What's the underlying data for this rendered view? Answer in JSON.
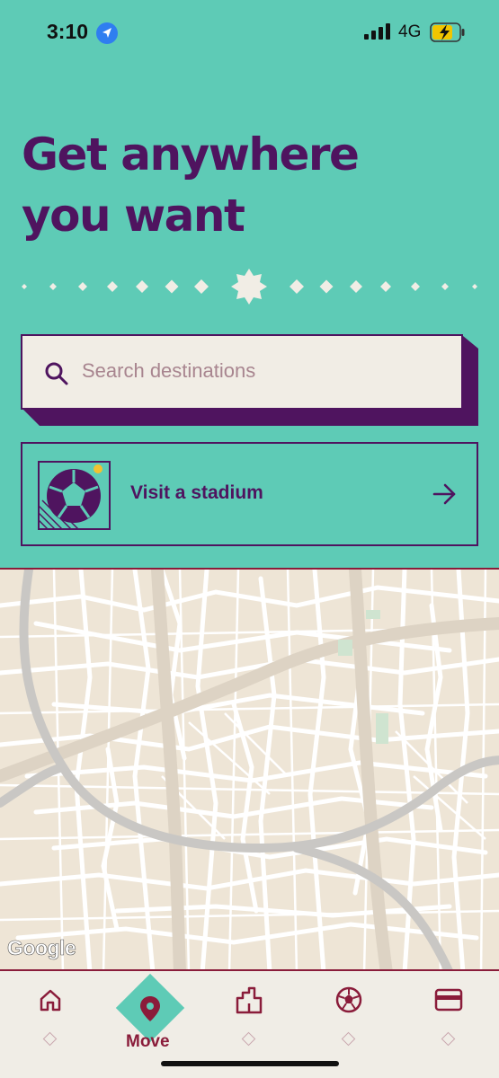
{
  "status_bar": {
    "time": "3:10",
    "network": "4G"
  },
  "hero": {
    "title_line1": "Get anywhere",
    "title_line2": "you want"
  },
  "search": {
    "placeholder": "Search destinations"
  },
  "stadium_card": {
    "label": "Visit a stadium"
  },
  "map": {
    "attribution": "Google"
  },
  "tabbar": {
    "active": "move",
    "move_label": "Move",
    "tabs": [
      "home-icon",
      "location-pin-icon",
      "building-icon",
      "football-icon",
      "card-icon"
    ]
  },
  "colors": {
    "teal": "#5ecbb6",
    "purple": "#4f145f",
    "maroon": "#8a1c3a",
    "cream": "#f1ede5",
    "map_bg": "#eee5d6"
  }
}
